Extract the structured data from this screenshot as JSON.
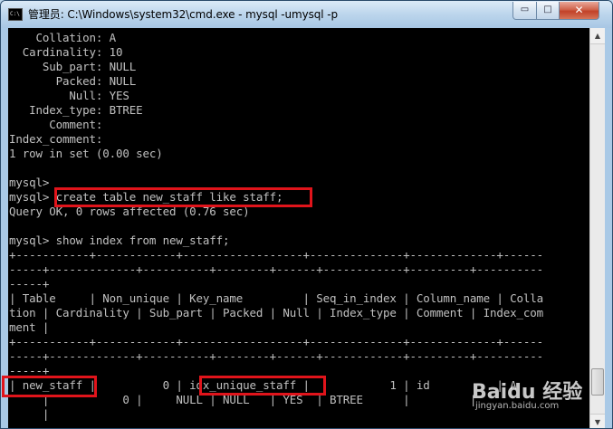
{
  "window": {
    "title": "管理员: C:\\Windows\\system32\\cmd.exe - mysql  -umysql -p",
    "icon_label": "C:\\"
  },
  "controls": {
    "minimize": "▭",
    "maximize": "□",
    "close": "✕"
  },
  "scrollbar": {
    "up": "▲",
    "down": "▼"
  },
  "console_lines": [
    "    Collation: A",
    "  Cardinality: 10",
    "     Sub_part: NULL",
    "       Packed: NULL",
    "         Null: YES",
    "   Index_type: BTREE",
    "      Comment: ",
    "Index_comment: ",
    "1 row in set (0.00 sec)",
    "",
    "mysql>",
    "mysql> create table new_staff like staff;",
    "Query OK, 0 rows affected (0.76 sec)",
    "",
    "mysql> show index from new_staff;",
    "+-----------+------------+------------------+--------------+-------------+------",
    "-----+-------------+----------+--------+------+------------+---------+----------",
    "-----+",
    "| Table     | Non_unique | Key_name         | Seq_in_index | Column_name | Colla",
    "tion | Cardinality | Sub_part | Packed | Null | Index_type | Comment | Index_com",
    "ment |",
    "+-----------+------------+------------------+--------------+-------------+------",
    "-----+-------------+----------+--------+------+------------+---------+----------",
    "-----+",
    "| new_staff |          0 | idx_unique_staff |            1 | id          | A",
    "     |           0 |     NULL | NULL   | YES  | BTREE      |         |",
    "     |"
  ],
  "watermark": {
    "brand": "Baidu 经验",
    "url": "jingyan.baidu.com"
  },
  "colors": {
    "console_bg": "#000000",
    "console_text": "#c0c0c0",
    "highlight": "#e0141b",
    "close_button": "#c24128"
  }
}
